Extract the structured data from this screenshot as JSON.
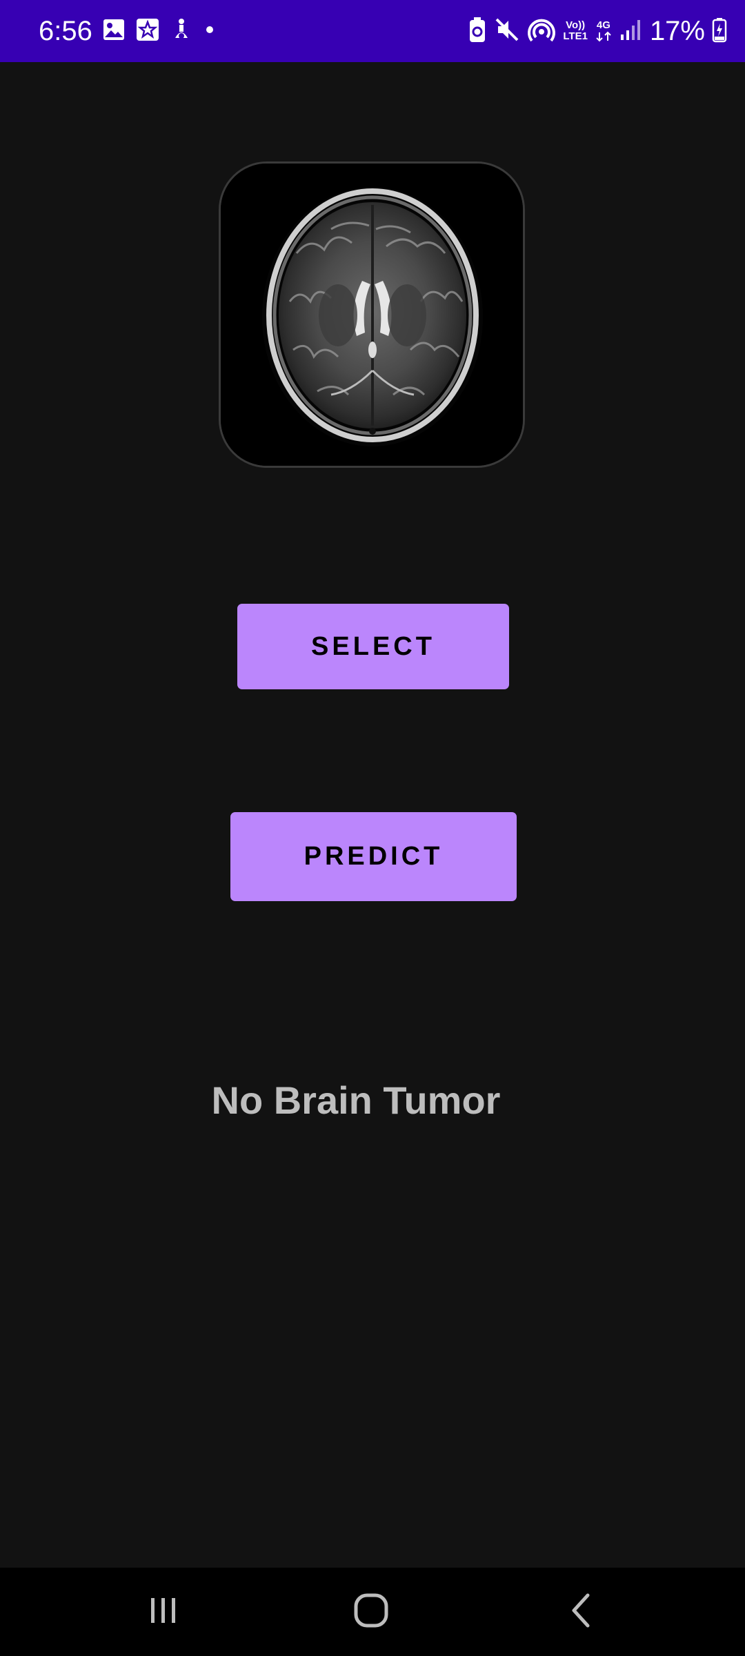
{
  "status_bar": {
    "time": "6:56",
    "left_icons": [
      "gallery-icon",
      "star-app-icon",
      "accessibility-icon",
      "dot-icon"
    ],
    "right_icons": [
      "battery-saver-icon",
      "mute-icon",
      "hotspot-icon",
      "volte-icon",
      "4g-icon",
      "signal-icon",
      "battery-charging-icon"
    ],
    "volte_line1": "Vo))",
    "volte_line2": "LTE1",
    "network_type": "4G",
    "battery_percent": "17%",
    "background": "#3700b3"
  },
  "main": {
    "image": "brain-mri-image",
    "select_button_label": "SELECT",
    "predict_button_label": "PREDICT",
    "result_text": "No Brain Tumor",
    "accent_color": "#bb86fc",
    "background": "#121212"
  },
  "nav_bar": {
    "buttons": [
      "recents-icon",
      "home-icon",
      "back-icon"
    ]
  }
}
